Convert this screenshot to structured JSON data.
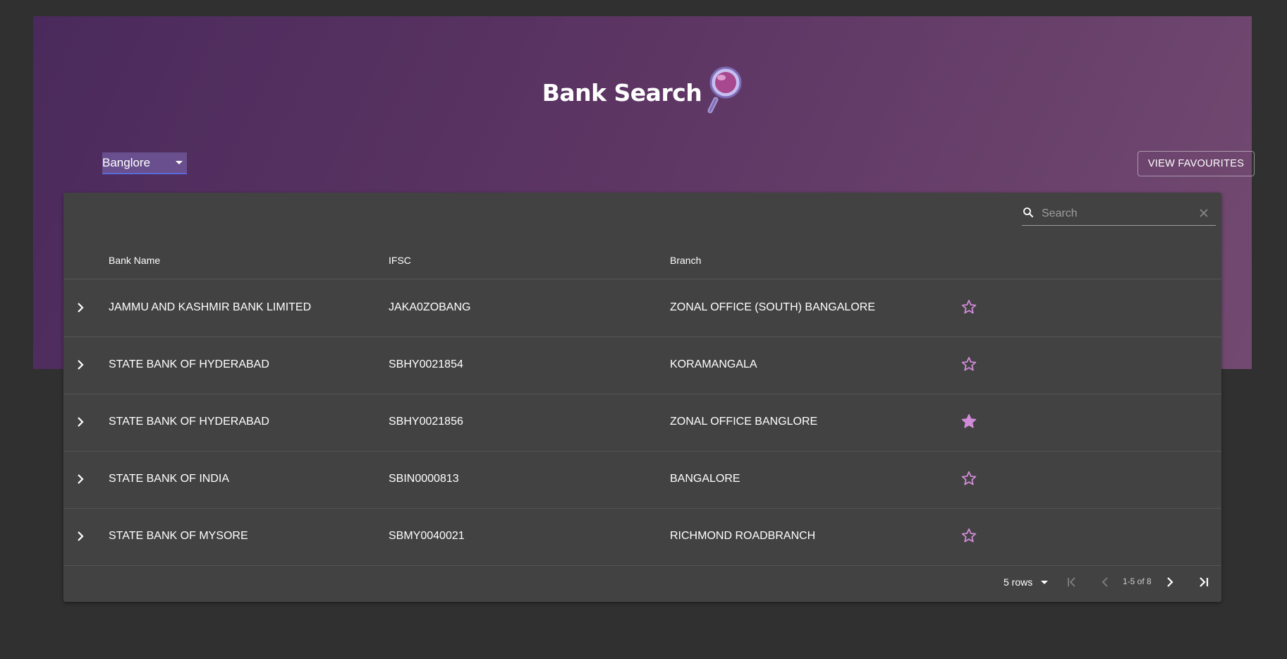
{
  "header": {
    "title": "Bank Search"
  },
  "city_select": {
    "value": "Banglore"
  },
  "favourites_button": {
    "label": "VIEW FAVOURITES"
  },
  "search": {
    "placeholder": "Search"
  },
  "table": {
    "columns": [
      "Bank Name",
      "IFSC",
      "Branch"
    ],
    "rows": [
      {
        "bank": "JAMMU AND KASHMIR BANK LIMITED",
        "ifsc": "JAKA0ZOBANG",
        "branch": "ZONAL OFFICE (SOUTH) BANGALORE",
        "favourite": false
      },
      {
        "bank": "STATE BANK OF HYDERABAD",
        "ifsc": "SBHY0021854",
        "branch": "KORAMANGALA",
        "favourite": false
      },
      {
        "bank": "STATE BANK OF HYDERABAD",
        "ifsc": "SBHY0021856",
        "branch": "ZONAL OFFICE BANGLORE",
        "favourite": true
      },
      {
        "bank": "STATE BANK OF INDIA",
        "ifsc": "SBIN0000813",
        "branch": "BANGALORE",
        "favourite": false
      },
      {
        "bank": "STATE BANK OF MYSORE",
        "ifsc": "SBMY0040021",
        "branch": "RICHMOND ROADBRANCH",
        "favourite": false
      }
    ]
  },
  "pagination": {
    "rows_per_page": "5 rows",
    "range": "1-5 of 8"
  },
  "colors": {
    "accent": "#d18bd8",
    "background": "#303030",
    "panel": "#424242"
  }
}
